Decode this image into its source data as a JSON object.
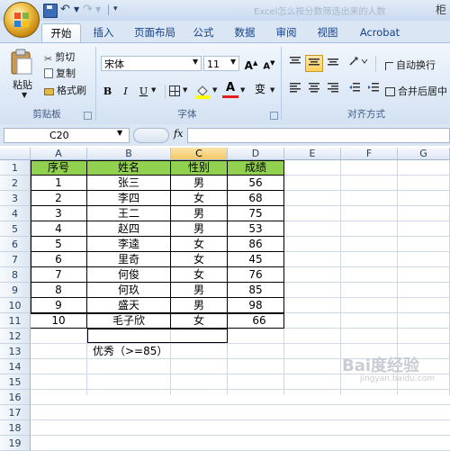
{
  "quick_access": {
    "title_text": "Excel怎么按分数筛选出来的人数"
  },
  "edge_char": "柜",
  "tabs": [
    "开始",
    "插入",
    "页面布局",
    "公式",
    "数据",
    "审阅",
    "视图",
    "Acrobat"
  ],
  "clipboard": {
    "paste_label": "粘贴",
    "cut_label": "剪切",
    "copy_label": "复制",
    "format_painter_label": "格式刷",
    "group_label": "剪贴板"
  },
  "font": {
    "name": "宋体",
    "size": "11",
    "grow_label": "A",
    "shrink_label": "A",
    "bold": "B",
    "italic": "I",
    "underline": "U",
    "font_color_label": "A",
    "phonetic_label": "变",
    "group_label": "字体"
  },
  "alignment": {
    "wrap_label": "自动换行",
    "merge_label": "合并后居中",
    "group_label": "对齐方式"
  },
  "formula_bar": {
    "name_box": "C20",
    "fx": "fx",
    "formula": ""
  },
  "sheet": {
    "columns": [
      "A",
      "B",
      "C",
      "D",
      "E",
      "F",
      "G"
    ],
    "rows": [
      "1",
      "2",
      "3",
      "4",
      "5",
      "6",
      "7",
      "8",
      "9",
      "10",
      "11",
      "12",
      "13",
      "14",
      "15",
      "16",
      "17",
      "18",
      "19"
    ],
    "table_header": [
      "序号",
      "姓名",
      "性别",
      "成绩"
    ],
    "table_rows": [
      [
        "1",
        "张三",
        "男",
        "56"
      ],
      [
        "2",
        "李四",
        "女",
        "68"
      ],
      [
        "3",
        "王二",
        "男",
        "75"
      ],
      [
        "4",
        "赵四",
        "男",
        "53"
      ],
      [
        "5",
        "李逵",
        "女",
        "86"
      ],
      [
        "6",
        "里奇",
        "女",
        "45"
      ],
      [
        "7",
        "何俊",
        "女",
        "76"
      ],
      [
        "8",
        "何玖",
        "男",
        "85"
      ],
      [
        "9",
        "盛天",
        "男",
        "98"
      ],
      [
        "10",
        "毛子欣",
        "女",
        "66"
      ]
    ],
    "b13": "优秀（>=85）"
  },
  "watermark": {
    "main": "Bai度经验",
    "sub": "jingyan.baidu.com"
  },
  "colors": {
    "header_fill": "#92d050",
    "ribbon_text": "#15428b"
  }
}
